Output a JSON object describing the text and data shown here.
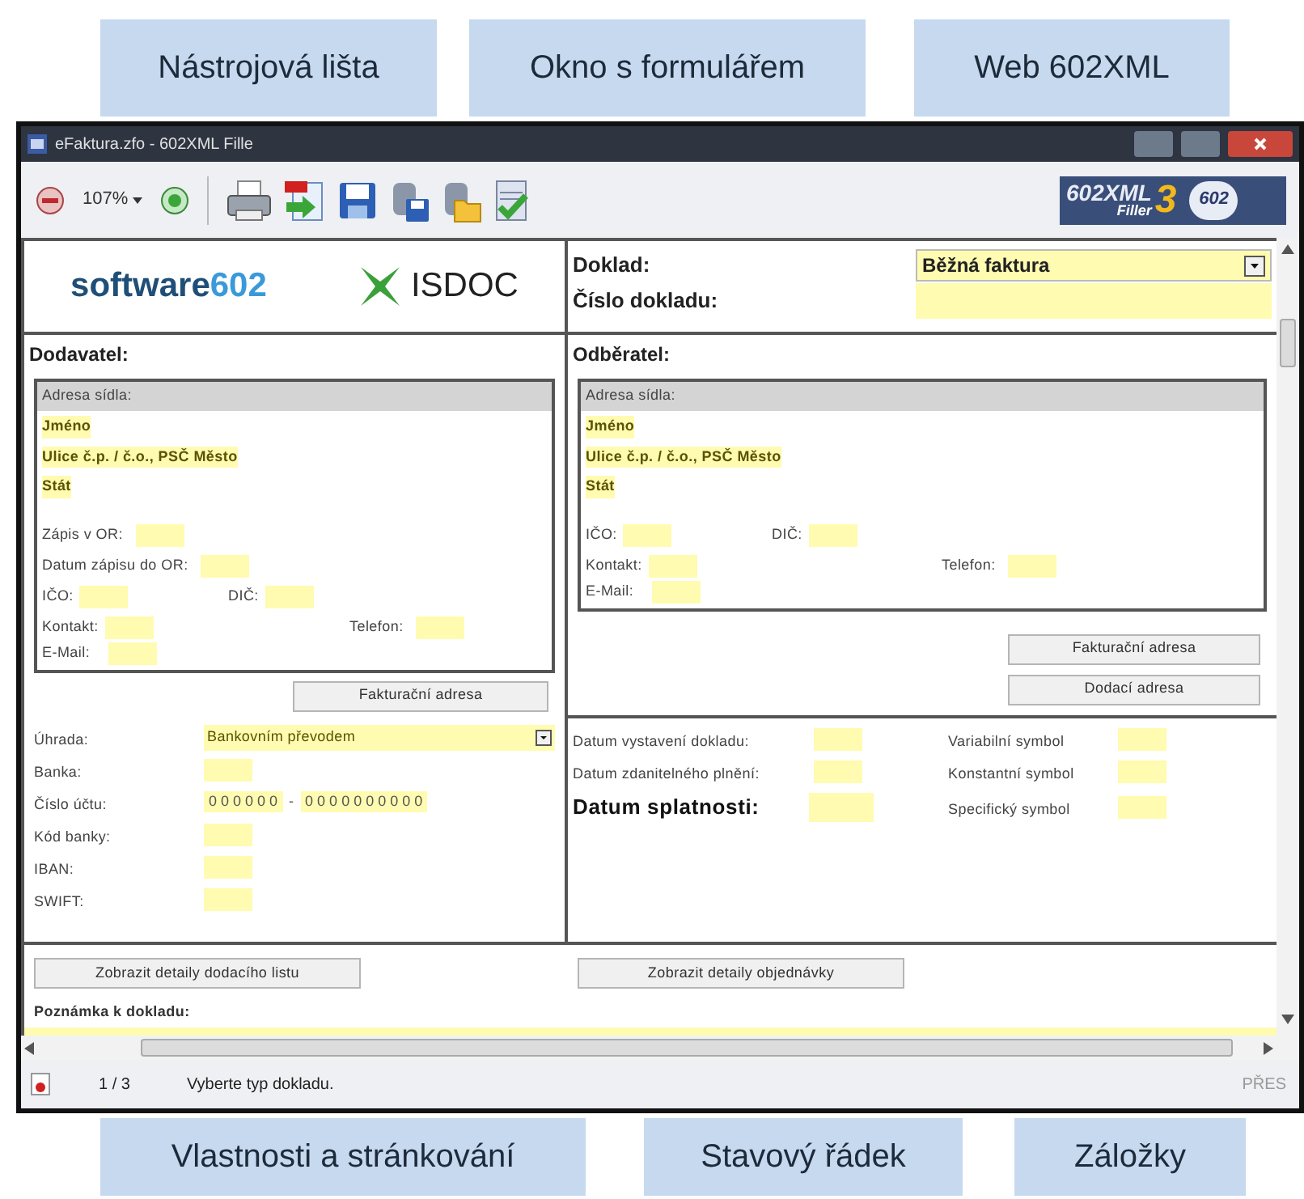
{
  "callouts_top": [
    {
      "text": "Nástrojová lišta"
    },
    {
      "text": "Okno s formulářem"
    },
    {
      "text": "Web 602XML"
    }
  ],
  "window": {
    "title": "eFaktura.zfo - 602XML Fille"
  },
  "toolbar": {
    "zoom": "107%",
    "icons": [
      {
        "kind": "print"
      },
      {
        "kind": "pdf"
      },
      {
        "kind": "save"
      },
      {
        "kind": "save_db"
      },
      {
        "kind": "open_db"
      },
      {
        "kind": "sign"
      }
    ]
  },
  "product_logo": {
    "name": "602XML",
    "sub": "Filler",
    "version": "3",
    "badge": "602"
  },
  "brand": {
    "vendor_name": "software",
    "vendor_number": "602",
    "standard": "ISDOC"
  },
  "document": {
    "type_label": "Doklad:",
    "type": "Běžná faktura",
    "number_label": "Číslo dokladu:"
  },
  "supplier": {
    "title": "Dodavatel:",
    "address_header": "Adresa sídla:",
    "name": "Jméno",
    "street": "Ulice č.p. / č.o., PSČ Město",
    "country": "Stát",
    "registry": [
      "Zápis v OR:",
      "Datum zápisu do OR:"
    ],
    "ids": [
      "IČO:",
      "DIČ:"
    ],
    "contact": [
      "Kontakt:",
      "Telefon:"
    ],
    "email": "E-Mail:",
    "buttons": [
      "Fakturační adresa"
    ]
  },
  "customer": {
    "title": "Odběratel:",
    "address_header": "Adresa sídla:",
    "name": "Jméno",
    "street": "Ulice č.p. / č.o., PSČ Město",
    "country": "Stát",
    "ids": [
      "IČO:",
      "DIČ:"
    ],
    "contact": [
      "Kontakt:",
      "Telefon:"
    ],
    "email": "E-Mail:",
    "buttons": [
      "Fakturační adresa",
      "Dodací adresa"
    ]
  },
  "payment": {
    "method_label": "Úhrada:",
    "method": "Bankovním převodem",
    "bank": "Banka:",
    "account_label": "Číslo účtu:",
    "account_prefix": "0 0 0 0 0 0",
    "account_separator": "-",
    "account_number": "0 0 0 0 0 0 0 0 0 0",
    "bank_code": "Kód banky:",
    "iban": "IBAN:",
    "swift": "SWIFT:"
  },
  "dates": [
    {
      "label": "Datum vystavení dokladu:",
      "kind": "normal"
    },
    {
      "label": "Datum zdanitelného plnění:",
      "kind": "normal"
    },
    {
      "label": "Datum splatnosti:",
      "kind": "main"
    }
  ],
  "symbols": [
    "Variabilní symbol",
    "Konstantní symbol",
    "Specifický symbol"
  ],
  "detail_buttons": [
    "Zobrazit detaily dodacího listu",
    "Zobrazit detaily objednávky"
  ],
  "note": {
    "label": "Poznámka k dokladu:"
  },
  "status_bar": {
    "page": "1 / 3",
    "message": "Vyberte typ dokladu.",
    "mode": "PŘES"
  },
  "callouts_bottom": [
    {
      "text": "Vlastnosti a stránkování"
    },
    {
      "text": "Stavový řádek"
    },
    {
      "text": "Záložky"
    }
  ]
}
